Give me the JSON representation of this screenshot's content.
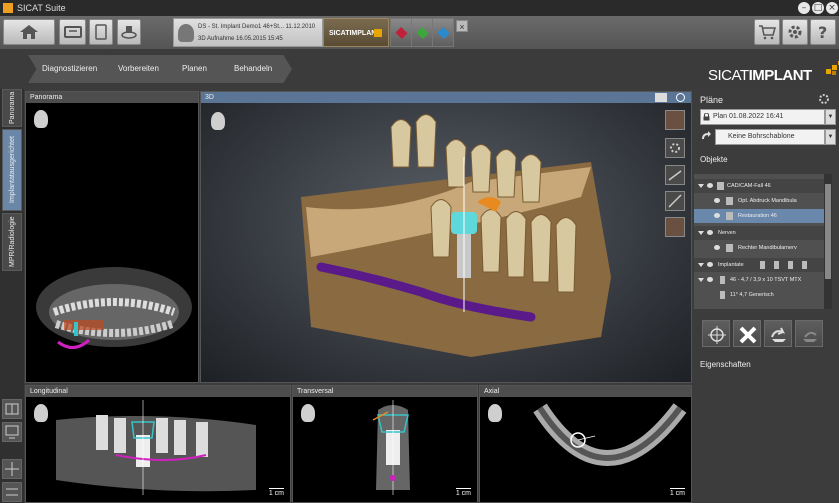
{
  "window": {
    "title": "SICAT Suite"
  },
  "patient": {
    "line1": "DS - St. Implant Demo1 46+St...  11.12.2010",
    "line2": "3D Aufnahme  16.05.2015 15:45"
  },
  "brand": {
    "tab_label": "SICATIMPLANT",
    "big_sicat": "SICAT",
    "big_implant": "IMPLANT"
  },
  "workflow": [
    "Diagnostizieren",
    "Vorbereiten",
    "Planen",
    "Behandeln"
  ],
  "left_tabs": [
    "Panorama",
    "Implantatausgerichtet",
    "MPR/Radiologie"
  ],
  "views": {
    "panorama": "Panorama",
    "three_d": "3D",
    "longitudinal": "Longitudinal",
    "transversal": "Transversal",
    "axial": "Axial",
    "scale": "1 cm"
  },
  "right": {
    "plans_heading": "Pläne",
    "plan_value": "Plan 01.08.2022 16:41",
    "guide_value": "Keine Bohrschablone",
    "objects_heading": "Objekte",
    "objects": [
      {
        "label": "CAD/CAM-Fall 46",
        "kind": "group"
      },
      {
        "label": "Opt. Abdruck Mandibula",
        "kind": "item"
      },
      {
        "label": "Restauration 46",
        "kind": "item-selected"
      },
      {
        "label": "Nerven",
        "kind": "group"
      },
      {
        "label": "Rechter Mandibularnerv",
        "kind": "item"
      },
      {
        "label": "Implantate",
        "kind": "group"
      },
      {
        "label": "46 - 4,7 / 3,9 x 10 TSVT MTX",
        "kind": "item"
      },
      {
        "label": "11° 4,7 Generisch",
        "kind": "subitem"
      }
    ],
    "properties_heading": "Eigenschaften"
  },
  "colors": {
    "accent": "#f0a020",
    "active_panel": "#5b7597",
    "selection": "#6a87ac",
    "nerve": "#7a1fa0",
    "implant": "#36c4c8"
  }
}
